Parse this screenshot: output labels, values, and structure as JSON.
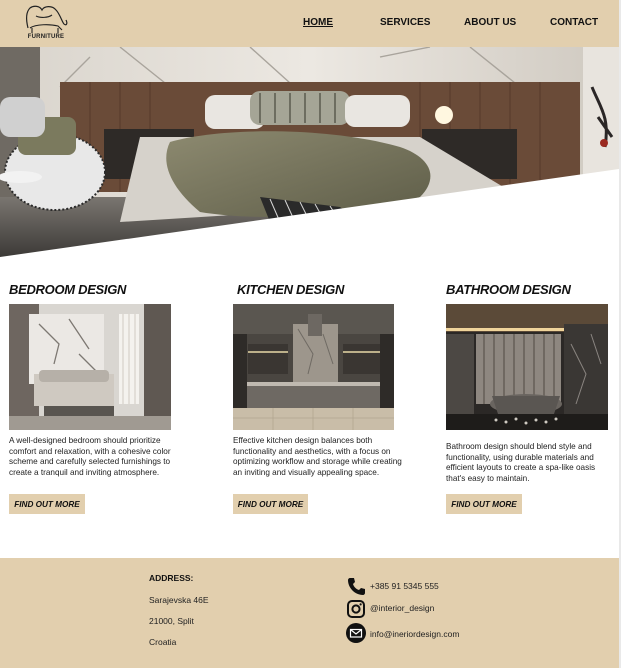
{
  "brand": {
    "logo_text": "FURNITURE"
  },
  "nav": {
    "home": "HOME",
    "services": "SERVICES",
    "about": "ABOUT US",
    "contact": "CONTACT"
  },
  "sections": [
    {
      "title": "BEDROOM DESIGN",
      "description": "A well-designed bedroom should prioritize comfort and relaxation, with a cohesive color scheme and carefully selected furnishings to create a tranquil and inviting atmosphere.",
      "button": "FIND OUT MORE"
    },
    {
      "title": "KITCHEN DESIGN",
      "description": "Effective kitchen design balances both functionality and aesthetics, with a focus on optimizing workflow and storage while creating an inviting and visually appealing space.",
      "button": "FIND OUT MORE"
    },
    {
      "title": "BATHROOM DESIGN",
      "description": "Bathroom design should blend style and functionality, using durable materials and efficient layouts to create a spa-like oasis that's easy to maintain.",
      "button": "FIND OUT MORE"
    }
  ],
  "footer": {
    "address_label": "ADDRESS:",
    "address_lines": [
      "Sarajevska 46E",
      "21000, Split",
      "Croatia"
    ],
    "phone": "+385 91 5345 555",
    "instagram": "@interior_design",
    "email": "info@ineriordesign.com"
  },
  "icons": [
    "logo-chair-icon",
    "phone-icon",
    "instagram-icon",
    "email-icon"
  ],
  "colors": {
    "header_bg": "#e2cfae",
    "footer_bg": "#e2cfae",
    "button_bg": "#e2cfae",
    "text": "#111111"
  }
}
